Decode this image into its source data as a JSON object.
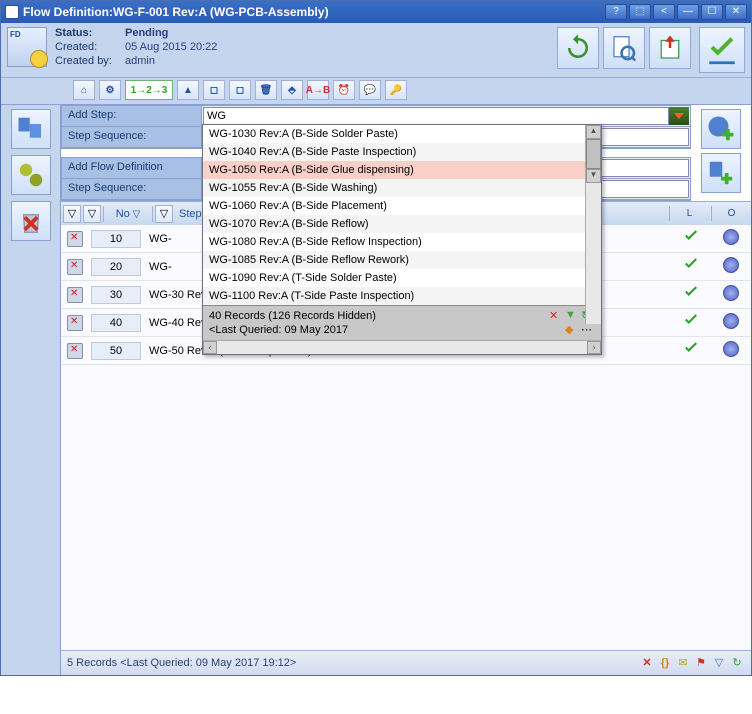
{
  "titlebar": {
    "title": "Flow Definition:WG-F-001 Rev:A (WG-PCB-Assembly)"
  },
  "header": {
    "status_label": "Status:",
    "status_value": "Pending",
    "created_label": "Created:",
    "created_value": "05 Aug 2015 20:22",
    "createdby_label": "Created by:",
    "createdby_value": "admin"
  },
  "form": {
    "add_step_label": "Add Step:",
    "add_step_value": "WG",
    "step_seq_label": "Step Sequence:",
    "add_flow_label": "Add Flow Definition",
    "step_seq2_label": "Step Sequence:"
  },
  "dropdown": {
    "items": [
      {
        "t": "WG-1030 Rev:A (B-Side Solder Paste)",
        "hl": 0
      },
      {
        "t": "WG-1040 Rev:A (B-Side Paste Inspection)",
        "hl": 0
      },
      {
        "t": "WG-1050 Rev:A (B-Side Glue dispensing)",
        "hl": 1
      },
      {
        "t": "WG-1055 Rev:A (B-Side Washing)",
        "hl": 0
      },
      {
        "t": "WG-1060 Rev:A (B-Side Placement)",
        "hl": 0
      },
      {
        "t": "WG-1070 Rev:A (B-Side Reflow)",
        "hl": 0
      },
      {
        "t": "WG-1080 Rev:A (B-Side Reflow Inspection)",
        "hl": 0
      },
      {
        "t": "WG-1085 Rev:A (B-Side Reflow Rework)",
        "hl": 0
      },
      {
        "t": "WG-1090 Rev:A (T-Side Solder Paste)",
        "hl": 0
      },
      {
        "t": "WG-1100 Rev:A (T-Side Paste Inspection)",
        "hl": 0
      }
    ],
    "footer1": "40 Records (126 Records Hidden)",
    "footer2": "<Last Queried: 09 May 2017"
  },
  "grid": {
    "col_no": "No",
    "col_step": "Step",
    "col_l": "L",
    "col_o": "O",
    "rows": [
      {
        "no": "10",
        "step": "WG-"
      },
      {
        "no": "20",
        "step": "WG-"
      },
      {
        "no": "30",
        "step": "WG-30 Rev:A (WG-Paste)"
      },
      {
        "no": "40",
        "step": "WG-40 Rev:A (WG-Inspection)"
      },
      {
        "no": "50",
        "step": "WG-50 Rev:A (WG-Components)"
      }
    ]
  },
  "statusbar": {
    "text": "5 Records <Last Queried: 09 May 2017 19:12>"
  }
}
